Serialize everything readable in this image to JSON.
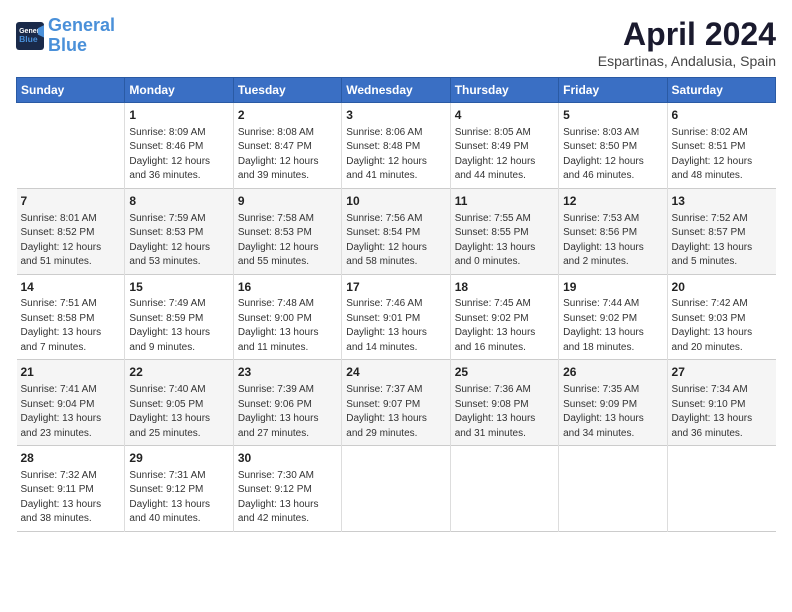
{
  "logo": {
    "line1": "General",
    "line2": "Blue"
  },
  "title": "April 2024",
  "subtitle": "Espartinas, Andalusia, Spain",
  "headers": [
    "Sunday",
    "Monday",
    "Tuesday",
    "Wednesday",
    "Thursday",
    "Friday",
    "Saturday"
  ],
  "weeks": [
    [
      {
        "day": "",
        "content": ""
      },
      {
        "day": "1",
        "content": "Sunrise: 8:09 AM\nSunset: 8:46 PM\nDaylight: 12 hours\nand 36 minutes."
      },
      {
        "day": "2",
        "content": "Sunrise: 8:08 AM\nSunset: 8:47 PM\nDaylight: 12 hours\nand 39 minutes."
      },
      {
        "day": "3",
        "content": "Sunrise: 8:06 AM\nSunset: 8:48 PM\nDaylight: 12 hours\nand 41 minutes."
      },
      {
        "day": "4",
        "content": "Sunrise: 8:05 AM\nSunset: 8:49 PM\nDaylight: 12 hours\nand 44 minutes."
      },
      {
        "day": "5",
        "content": "Sunrise: 8:03 AM\nSunset: 8:50 PM\nDaylight: 12 hours\nand 46 minutes."
      },
      {
        "day": "6",
        "content": "Sunrise: 8:02 AM\nSunset: 8:51 PM\nDaylight: 12 hours\nand 48 minutes."
      }
    ],
    [
      {
        "day": "7",
        "content": "Sunrise: 8:01 AM\nSunset: 8:52 PM\nDaylight: 12 hours\nand 51 minutes."
      },
      {
        "day": "8",
        "content": "Sunrise: 7:59 AM\nSunset: 8:53 PM\nDaylight: 12 hours\nand 53 minutes."
      },
      {
        "day": "9",
        "content": "Sunrise: 7:58 AM\nSunset: 8:53 PM\nDaylight: 12 hours\nand 55 minutes."
      },
      {
        "day": "10",
        "content": "Sunrise: 7:56 AM\nSunset: 8:54 PM\nDaylight: 12 hours\nand 58 minutes."
      },
      {
        "day": "11",
        "content": "Sunrise: 7:55 AM\nSunset: 8:55 PM\nDaylight: 13 hours\nand 0 minutes."
      },
      {
        "day": "12",
        "content": "Sunrise: 7:53 AM\nSunset: 8:56 PM\nDaylight: 13 hours\nand 2 minutes."
      },
      {
        "day": "13",
        "content": "Sunrise: 7:52 AM\nSunset: 8:57 PM\nDaylight: 13 hours\nand 5 minutes."
      }
    ],
    [
      {
        "day": "14",
        "content": "Sunrise: 7:51 AM\nSunset: 8:58 PM\nDaylight: 13 hours\nand 7 minutes."
      },
      {
        "day": "15",
        "content": "Sunrise: 7:49 AM\nSunset: 8:59 PM\nDaylight: 13 hours\nand 9 minutes."
      },
      {
        "day": "16",
        "content": "Sunrise: 7:48 AM\nSunset: 9:00 PM\nDaylight: 13 hours\nand 11 minutes."
      },
      {
        "day": "17",
        "content": "Sunrise: 7:46 AM\nSunset: 9:01 PM\nDaylight: 13 hours\nand 14 minutes."
      },
      {
        "day": "18",
        "content": "Sunrise: 7:45 AM\nSunset: 9:02 PM\nDaylight: 13 hours\nand 16 minutes."
      },
      {
        "day": "19",
        "content": "Sunrise: 7:44 AM\nSunset: 9:02 PM\nDaylight: 13 hours\nand 18 minutes."
      },
      {
        "day": "20",
        "content": "Sunrise: 7:42 AM\nSunset: 9:03 PM\nDaylight: 13 hours\nand 20 minutes."
      }
    ],
    [
      {
        "day": "21",
        "content": "Sunrise: 7:41 AM\nSunset: 9:04 PM\nDaylight: 13 hours\nand 23 minutes."
      },
      {
        "day": "22",
        "content": "Sunrise: 7:40 AM\nSunset: 9:05 PM\nDaylight: 13 hours\nand 25 minutes."
      },
      {
        "day": "23",
        "content": "Sunrise: 7:39 AM\nSunset: 9:06 PM\nDaylight: 13 hours\nand 27 minutes."
      },
      {
        "day": "24",
        "content": "Sunrise: 7:37 AM\nSunset: 9:07 PM\nDaylight: 13 hours\nand 29 minutes."
      },
      {
        "day": "25",
        "content": "Sunrise: 7:36 AM\nSunset: 9:08 PM\nDaylight: 13 hours\nand 31 minutes."
      },
      {
        "day": "26",
        "content": "Sunrise: 7:35 AM\nSunset: 9:09 PM\nDaylight: 13 hours\nand 34 minutes."
      },
      {
        "day": "27",
        "content": "Sunrise: 7:34 AM\nSunset: 9:10 PM\nDaylight: 13 hours\nand 36 minutes."
      }
    ],
    [
      {
        "day": "28",
        "content": "Sunrise: 7:32 AM\nSunset: 9:11 PM\nDaylight: 13 hours\nand 38 minutes."
      },
      {
        "day": "29",
        "content": "Sunrise: 7:31 AM\nSunset: 9:12 PM\nDaylight: 13 hours\nand 40 minutes."
      },
      {
        "day": "30",
        "content": "Sunrise: 7:30 AM\nSunset: 9:12 PM\nDaylight: 13 hours\nand 42 minutes."
      },
      {
        "day": "",
        "content": ""
      },
      {
        "day": "",
        "content": ""
      },
      {
        "day": "",
        "content": ""
      },
      {
        "day": "",
        "content": ""
      }
    ]
  ]
}
